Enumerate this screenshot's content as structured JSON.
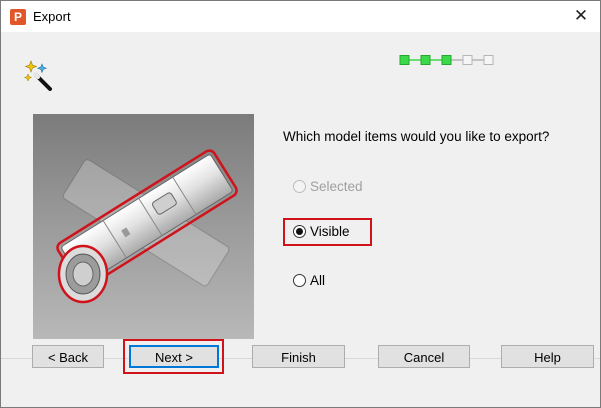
{
  "window": {
    "title": "Export",
    "app_icon_letter": "P",
    "close_glyph": "✕"
  },
  "colors": {
    "accent_red": "#d0121b",
    "step_active": "#3cd94a",
    "button_focus": "#0078d7"
  },
  "wizard": {
    "icon": "wizard-wand-icon",
    "steps_total": 5,
    "steps_completed": 3
  },
  "question": "Which model items would you like to export?",
  "options": [
    {
      "label": "Selected",
      "checked": false,
      "enabled": false
    },
    {
      "label": "Visible",
      "checked": true,
      "enabled": true
    },
    {
      "label": "All",
      "checked": false,
      "enabled": true
    }
  ],
  "buttons": {
    "back": "< Back",
    "next": "Next >",
    "finish": "Finish",
    "cancel": "Cancel",
    "help": "Help"
  }
}
